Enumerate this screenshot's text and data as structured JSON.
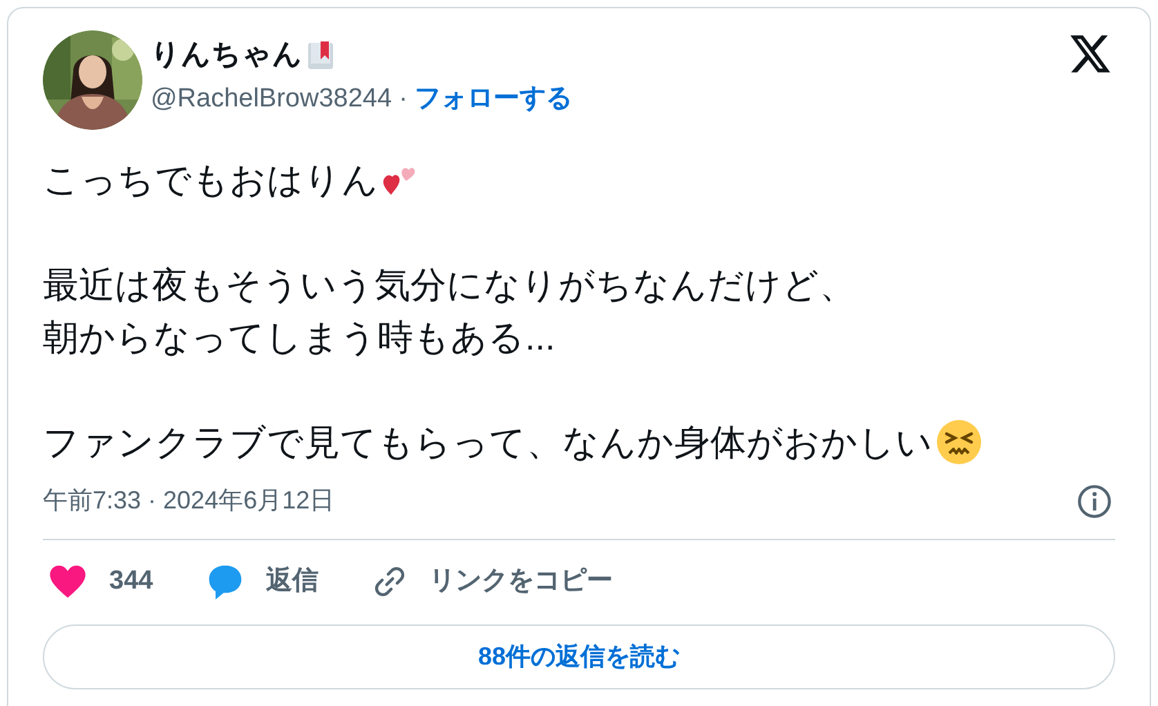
{
  "author": {
    "name": "りんちゃん",
    "handle": "@RachelBrow38244",
    "separator": "·",
    "follow": "フォローする"
  },
  "body": [
    [
      "こっちでもおはりん"
    ],
    [
      "最近は夜もそういう気分になりがちなんだけど、",
      "朝からなってしまう時もある..."
    ],
    [
      "ファンクラブで見てもらって、なんか身体がおかしい"
    ]
  ],
  "timestamp": "午前7:33 · 2024年6月12日",
  "actions": [
    {
      "kind": "like",
      "label": "344"
    },
    {
      "kind": "reply",
      "label": "返信"
    },
    {
      "kind": "link",
      "label": "リンクをコピー"
    }
  ],
  "read_replies": "88件の返信を読む"
}
